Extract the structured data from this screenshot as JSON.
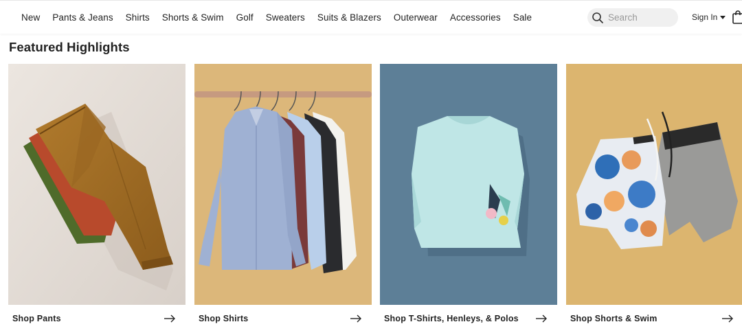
{
  "nav": {
    "items": [
      {
        "label": "New"
      },
      {
        "label": "Pants & Jeans"
      },
      {
        "label": "Shirts"
      },
      {
        "label": "Shorts & Swim"
      },
      {
        "label": "Golf"
      },
      {
        "label": "Sweaters"
      },
      {
        "label": "Suits & Blazers"
      },
      {
        "label": "Outerwear"
      },
      {
        "label": "Accessories"
      },
      {
        "label": "Sale"
      }
    ],
    "search_placeholder": "Search",
    "signin_label": "Sign In"
  },
  "main": {
    "title": "Featured Highlights",
    "cards": [
      {
        "label": "Shop Pants",
        "icon": "arrow-right-icon"
      },
      {
        "label": "Shop Shirts",
        "icon": "arrow-right-icon"
      },
      {
        "label": "Shop T-Shirts, Henleys, & Polos",
        "icon": "arrow-right-icon"
      },
      {
        "label": "Shop Shorts & Swim",
        "icon": "arrow-right-icon"
      }
    ]
  },
  "colors": {
    "pants_bg": "#e5ded8",
    "shirts_bg": "#dcb77a",
    "tshirt_bg": "#5d7f97",
    "shorts_bg": "#dcb56f"
  }
}
